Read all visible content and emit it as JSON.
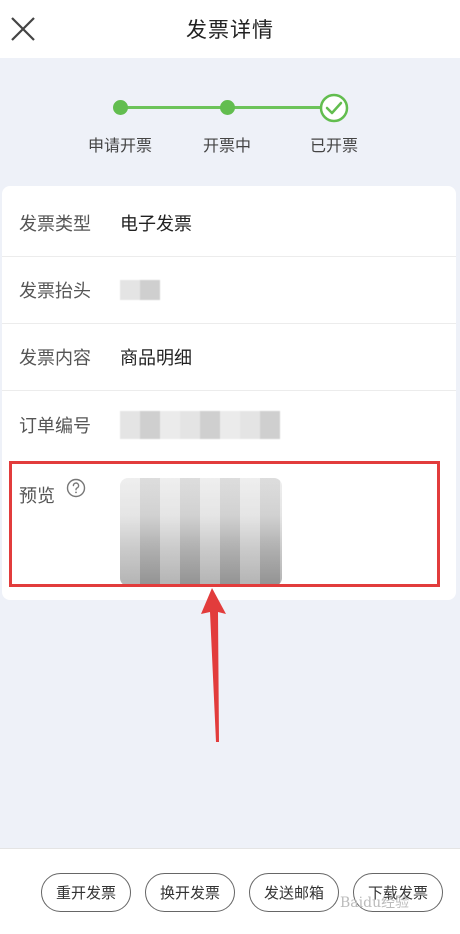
{
  "header": {
    "title": "发票详情"
  },
  "steps": [
    {
      "label": "申请开票"
    },
    {
      "label": "开票中"
    },
    {
      "label": "已开票"
    }
  ],
  "details": {
    "type_label": "发票类型",
    "type_value": "电子发票",
    "title_label": "发票抬头",
    "content_label": "发票内容",
    "content_value": "商品明细",
    "order_label": "订单编号",
    "preview_label": "预览"
  },
  "actions": {
    "reissue": "重开发票",
    "exchange": "换开发票",
    "email": "发送邮箱",
    "download": "下载发票"
  },
  "watermark": "Baidu经验",
  "colors": {
    "accent_green": "#62bd4f",
    "highlight_red": "#e23c3c"
  }
}
